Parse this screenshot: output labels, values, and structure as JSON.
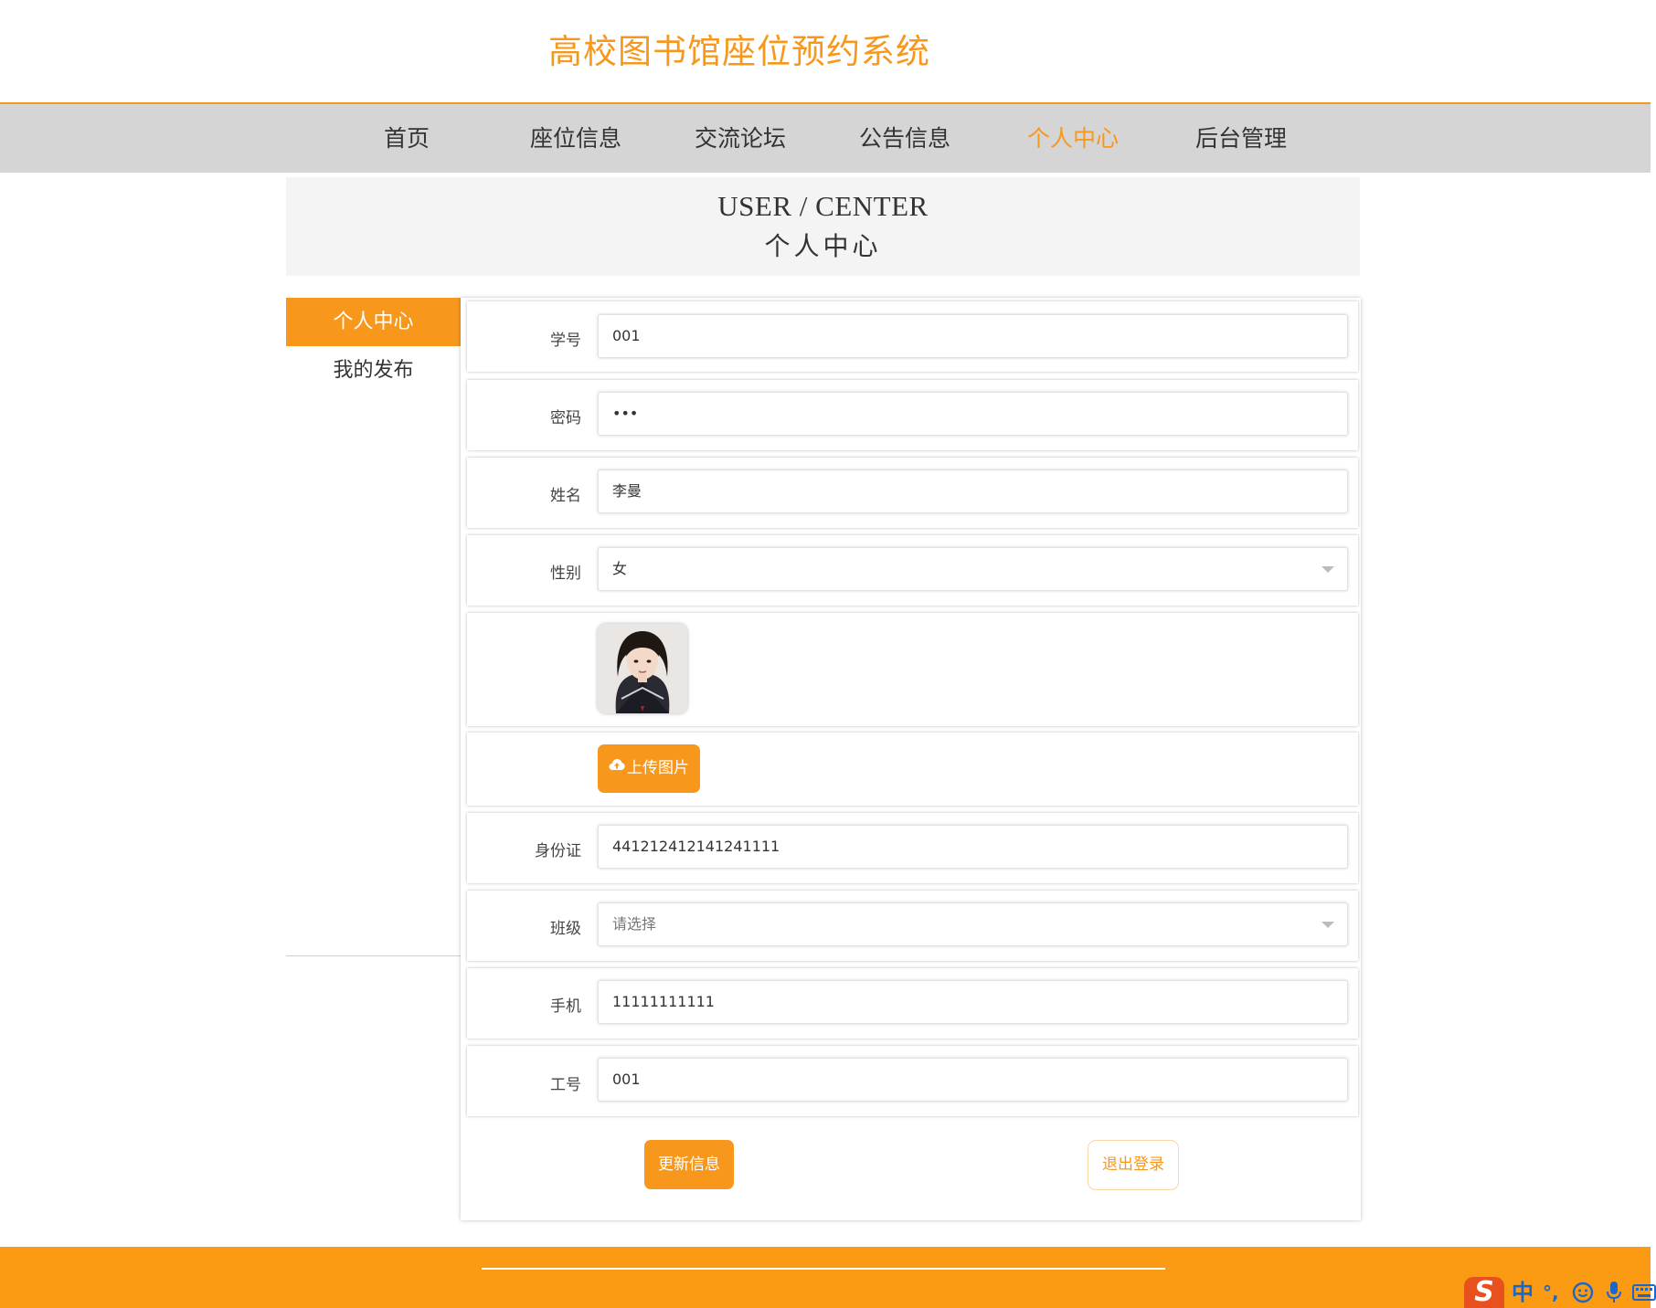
{
  "header": {
    "site_title": "高校图书馆座位预约系统"
  },
  "nav": {
    "items": [
      {
        "label": "首页"
      },
      {
        "label": "座位信息"
      },
      {
        "label": "交流论坛"
      },
      {
        "label": "公告信息"
      },
      {
        "label": "个人中心",
        "active": true
      },
      {
        "label": "后台管理"
      }
    ]
  },
  "banner": {
    "title_en": "USER / CENTER",
    "title_cn": "个人中心"
  },
  "sidebar": {
    "items": [
      {
        "label": "个人中心",
        "active": true
      },
      {
        "label": "我的发布"
      }
    ]
  },
  "form": {
    "student_no": {
      "label": "学号",
      "value": "001"
    },
    "password": {
      "label": "密码",
      "value": "•••"
    },
    "name": {
      "label": "姓名",
      "value": "李曼"
    },
    "gender": {
      "label": "性别",
      "value": "女"
    },
    "photo": {
      "icon": "user-photo"
    },
    "upload_label": "上传图片",
    "id_card": {
      "label": "身份证",
      "value": "441212412141241111"
    },
    "class": {
      "label": "班级",
      "placeholder": "请选择"
    },
    "phone": {
      "label": "手机",
      "value": "11111111111"
    },
    "work_no": {
      "label": "工号",
      "value": "001"
    }
  },
  "actions": {
    "update_label": "更新信息",
    "logout_label": "退出登录"
  },
  "ime": {
    "mode": "中",
    "punct": "°,",
    "icons": [
      "sogou-s-icon",
      "smiley-icon",
      "microphone-icon",
      "keyboard-icon"
    ]
  },
  "colors": {
    "accent": "#f7981c",
    "nav_bg": "#d5d5d5",
    "banner_bg": "#f4f4f4",
    "footer_bg": "#fb9a13"
  }
}
